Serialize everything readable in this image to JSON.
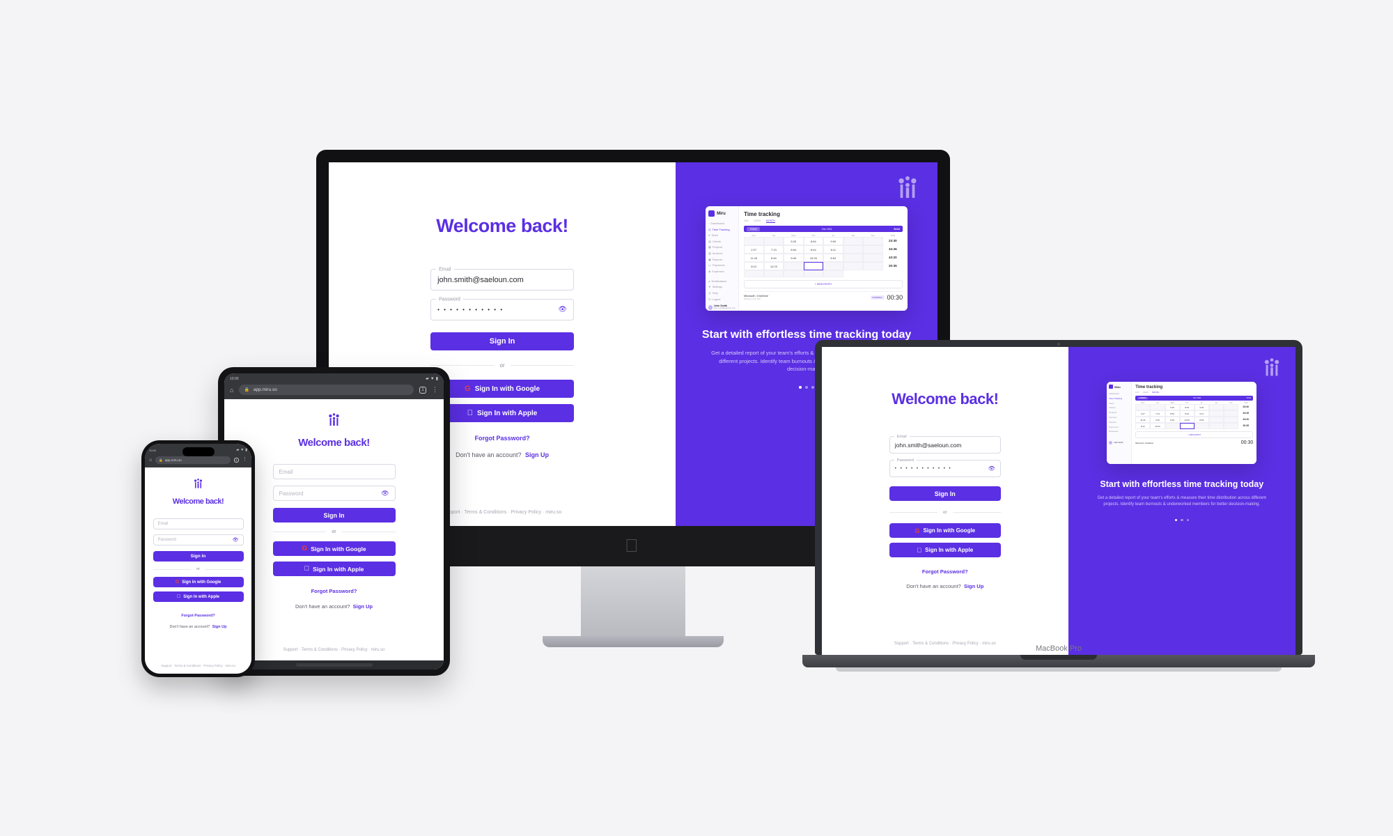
{
  "brand": {
    "name": "Miru",
    "logo_icon": "miru-logo-icon",
    "domain": "miru.so"
  },
  "auth": {
    "title": "Welcome back!",
    "email": {
      "legend": "Email",
      "placeholder": "Email",
      "value": "john.smith@saeloun.com"
    },
    "password": {
      "legend": "Password",
      "placeholder": "Password",
      "value": "• • • • • • • • • • •",
      "toggle_icon": "eye-icon"
    },
    "signin_label": "Sign In",
    "divider_label": "or",
    "google_label": "Sign In with Google",
    "google_icon": "google-icon",
    "apple_label": "Sign In with Apple",
    "apple_icon": "apple-icon",
    "forgot_label": "Forgot Password?",
    "no_account_text": "Don't have an account?",
    "signup_label": "Sign Up",
    "footer": {
      "items": [
        "Support",
        "Terms & Conditions",
        "Privacy Policy",
        "miru.so"
      ],
      "separator": "·",
      "text": "Support  ·  Terms & Conditions  ·  Privacy Policy  ·  miru.so"
    }
  },
  "hero": {
    "title_desktop": "Start with effortless time tracking today",
    "title_laptop": "Start with effortless time tracking today",
    "subtitle": "Get a detailed report of your team's efforts & measure their time distribution across different projects. Identify team burnouts & underworked members for better decision-making.",
    "slide_count": 3,
    "active_slide": 1
  },
  "preview": {
    "app_name": "Miru",
    "page_title": "Time tracking",
    "tabs": [
      "DAY",
      "WEEK",
      "MONTH"
    ],
    "active_tab": "MONTH",
    "toolbar": {
      "today_label": "TODAY",
      "period": "Dec 2021",
      "total_label": "TOTAL",
      "total_value": "54:64"
    },
    "nav": [
      {
        "label": "Dashboard",
        "icon": "dashboard-icon",
        "active": false
      },
      {
        "label": "Time Tracking",
        "icon": "clock-icon",
        "active": true
      },
      {
        "label": "Team",
        "icon": "team-icon",
        "active": false
      },
      {
        "label": "Clients",
        "icon": "clients-icon",
        "active": false
      },
      {
        "label": "Projects",
        "icon": "projects-icon",
        "active": false
      },
      {
        "label": "Invoices",
        "icon": "invoices-icon",
        "active": false
      },
      {
        "label": "Reports",
        "icon": "reports-icon",
        "active": false
      },
      {
        "label": "Payments",
        "icon": "payments-icon",
        "active": false
      },
      {
        "label": "Expenses",
        "icon": "expenses-icon",
        "active": false
      }
    ],
    "nav_bottom": [
      {
        "label": "Notifications",
        "icon": "bell-icon"
      },
      {
        "label": "Settings",
        "icon": "gear-icon"
      },
      {
        "label": "Help",
        "icon": "help-icon"
      },
      {
        "label": "Logout",
        "icon": "logout-icon"
      }
    ],
    "user": {
      "name": "John Smith",
      "email": "john.smith@saeloun.com",
      "avatar_icon": "avatar-icon"
    },
    "calendar": {
      "headers": [
        "Mon",
        "Tue",
        "Wed",
        "Thu",
        "Fri",
        "Sat",
        "Sun",
        "Total"
      ],
      "rows": [
        {
          "cells": [
            "",
            "",
            "5:25",
            "8:54",
            "9:00",
            "",
            ""
          ],
          "total": "23:30"
        },
        {
          "cells": [
            "2:27",
            "7:13",
            "8:54",
            "8:44",
            "6:11",
            "",
            ""
          ],
          "total": "34:45"
        },
        {
          "cells": [
            "11:43",
            "6:45",
            "5:49",
            "10:33",
            "8:54",
            "",
            ""
          ],
          "total": "43:20"
        },
        {
          "cells": [
            "8:12",
            "12:23",
            "",
            "",
            "",
            "",
            ""
          ],
          "total": "20:35"
        },
        {
          "cells": [
            "",
            "",
            "",
            "",
            "",
            "",
            ""
          ],
          "total": ""
        }
      ],
      "selected_row": 3,
      "selected_col": 3
    },
    "new_entry_label": "+ NEW ENTRY",
    "timer": {
      "project": "Microsoft • OneDrive",
      "note": "Worked on the filter",
      "badge": "RUNNING",
      "value": "00:30"
    }
  },
  "browser": {
    "status_time": "10:00",
    "url": "app.miru.so",
    "lock_icon": "lock-icon",
    "home_icon": "home-icon",
    "tab_count": "1",
    "menu_icon": "kebab-menu-icon",
    "signal_icon": "signal-icon",
    "wifi_icon": "wifi-icon",
    "battery_icon": "battery-icon"
  },
  "devices": {
    "laptop_label": "MacBook Pro"
  },
  "colors": {
    "brand": "#5b2fe3",
    "background": "#f4f4f6",
    "text": "#2b2b33",
    "muted": "#a8a8b4"
  }
}
